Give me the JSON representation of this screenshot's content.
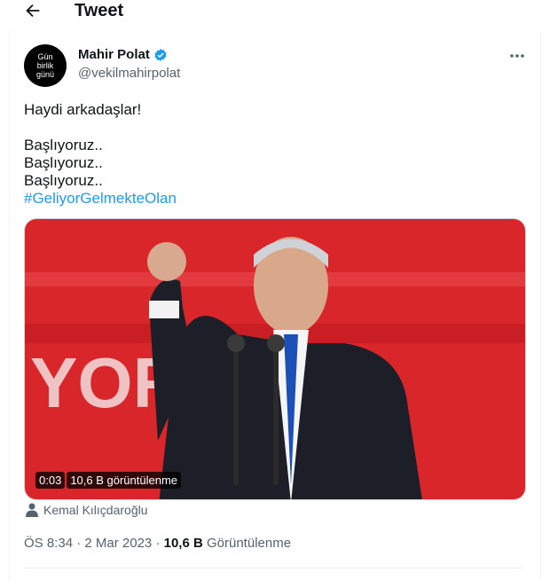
{
  "header": {
    "title": "Tweet",
    "back_icon": "arrow-left-icon"
  },
  "author": {
    "name": "Mahir Polat",
    "handle": "@vekilmahirpolat",
    "avatar_lines": [
      "Gün",
      "birlik",
      "günü"
    ],
    "verified_color": "#1d9bf0"
  },
  "tweet": {
    "lines": [
      "Haydi arkadaşlar!",
      "",
      "Başlıyoruz..",
      "Başlıyoruz..",
      "Başlıyoruz.."
    ],
    "hashtag": "#GeliyorGelmekteOlan"
  },
  "media": {
    "time": "0:03",
    "views": "10,6 B görüntülenme",
    "bg_text": "YOR   EY D",
    "accent": "#e3262b"
  },
  "tagged": {
    "name": "Kemal Kılıçdaroğlu"
  },
  "meta": {
    "time": "ÖS 8:34",
    "sep1": " · ",
    "date": "2 Mar 2023",
    "sep2": " · ",
    "views_count": "10,6 B",
    "views_label": " Görüntülenme"
  }
}
